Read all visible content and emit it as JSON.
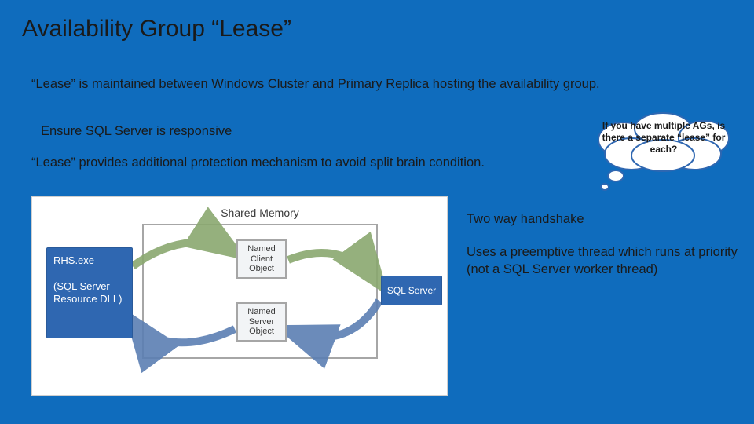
{
  "slide": {
    "title": "Availability Group “Lease”",
    "subtitle": "“Lease” is maintained between Windows Cluster and Primary Replica hosting the availability group.",
    "bullets": [
      "Ensure SQL Server is responsive",
      "“Lease” provides additional protection mechanism to avoid split brain condition."
    ],
    "cloud_text": "If you have multiple AGs, is there a separate “lease” for each?",
    "right_points": [
      "Two way handshake",
      "Uses a preemptive thread which runs at priority (not a SQL Server worker thread)"
    ]
  },
  "diagram": {
    "shared_memory_label": "Shared Memory",
    "left_box": "RHS.exe\n\n(SQL Server Resource DLL)",
    "right_box": "SQL Server",
    "client_object": "Named Client Object",
    "server_object": "Named Server Object"
  },
  "colors": {
    "background": "#0f6cbd",
    "box_blue": "#2f67b1",
    "arrow_green": "#8aa86f",
    "arrow_blue": "#5b7fb3"
  }
}
